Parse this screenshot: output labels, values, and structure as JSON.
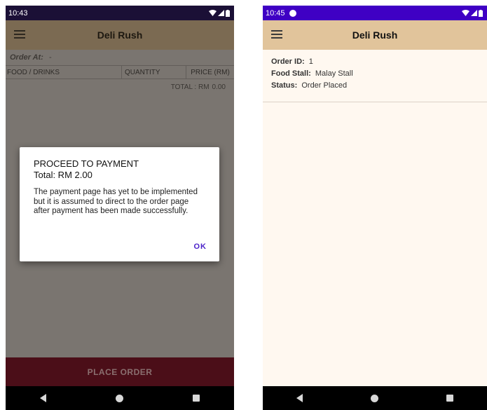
{
  "left": {
    "status": {
      "time": "10:43"
    },
    "appbar": {
      "title": "Deli Rush"
    },
    "order_at": {
      "label": "Order At:",
      "value": "-"
    },
    "table": {
      "headers": [
        "FOOD / DRINKS",
        "QUANTITY",
        "PRICE (RM)"
      ]
    },
    "total": {
      "label": "TOTAL : RM",
      "amount": "0.00"
    },
    "place_order_label": "PLACE ORDER",
    "dialog": {
      "title": "PROCEED TO PAYMENT",
      "total": "Total: RM 2.00",
      "message": "The payment page has yet to be implemented but it is assumed to direct to the order page after payment has been made successfully.",
      "ok_label": "OK"
    }
  },
  "right": {
    "status": {
      "time": "10:45"
    },
    "appbar": {
      "title": "Deli Rush"
    },
    "order": {
      "id_label": "Order ID:",
      "id_value": "1",
      "stall_label": "Food Stall:",
      "stall_value": "Malay Stall",
      "status_label": "Status:",
      "status_value": "Order Placed"
    }
  },
  "icons": [
    "menu-icon",
    "wifi-icon",
    "signal-icon",
    "battery-icon",
    "back-icon",
    "home-icon",
    "recents-icon"
  ],
  "colors": {
    "appbar": "#e1c49b",
    "place_order": "#4b0e18",
    "accent": "#4b22c9"
  }
}
